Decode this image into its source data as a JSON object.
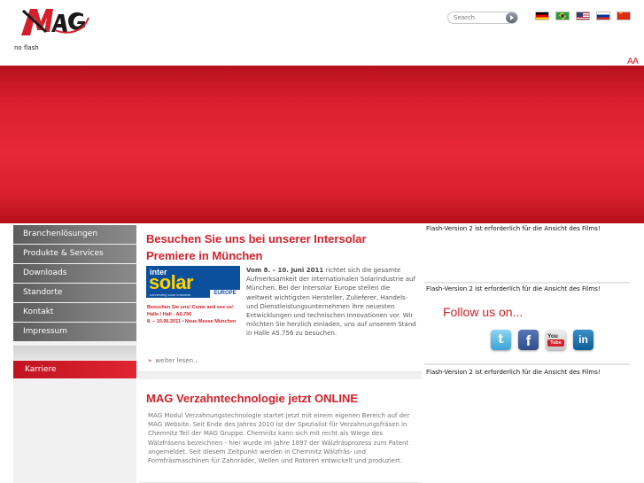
{
  "header": {
    "logo_text": "MAG",
    "noflash": "no flash",
    "search_placeholder": "Search",
    "font_size_control": "AA",
    "flags": [
      "german-flag-icon",
      "brazil-flag-icon",
      "usa-flag-icon",
      "russia-flag-icon",
      "china-flag-icon"
    ]
  },
  "sidebar": {
    "items": [
      {
        "label": "Branchenlösungen"
      },
      {
        "label": "Produkte & Services"
      },
      {
        "label": "Downloads"
      },
      {
        "label": "Standorte"
      },
      {
        "label": "Kontakt"
      },
      {
        "label": "Impressum"
      }
    ],
    "karriere": "Karriere"
  },
  "articles": [
    {
      "title": "Besuchen Sie uns bei unserer Intersolar Premiere in München",
      "date_bold": "Vom 8. – 10. Juni 2011",
      "body": " richtet sich die gesamte Aufmerksamkeit der internationalen Solarindustrie auf München. Bei der Intersolar Europe stellen die weltweit wichtigsten Hersteller, Zulieferer, Handels- und Dienstleistungsunternehmen ihre neuesten Entwicklungen und technischen Innovationen vor. Wir möchten Sie herzlich einladen, uns auf unserem Stand in Halle A5.756 zu besuchen.",
      "more": "weiter lesen...",
      "ad": {
        "inter": "inter",
        "solar": "solar",
        "tagline": "connecting solar business",
        "europe": "EUROPE",
        "line1": "Besuchen Sie uns! Come and see us!",
        "line2": "Halle / Hall - A5.756",
        "line3": "8. – 10.06.2011 • Neue Messe München"
      }
    },
    {
      "title": "MAG Verzahntechnologie jetzt ONLINE",
      "body": "MAG Modul Verzahnungstechnologie startet jetzt mit einem eigenen Bereich auf der MAG Website. Seit Ende des Jahres 2010 ist der Spezialist für Verzahnungsfräsen in Chemnitz Teil der MAG Gruppe. Chemnitz kann sich mit recht als Wiege des Wälzfräsens bezeichnen - hier wurde im Jahre 1897 der Wälzfräsprozess zum Patent angemeldet. Seit diesem Zeitpunkt werden in Chemnitz Wälzfräs- und Formfräsmaschinen für Zahnräder, Wellen und Rotoren entwickelt und produziert."
    }
  ],
  "right": {
    "flash_notice_1": "Flash-Version 2 ist erforderlich für die Ansicht des Films!",
    "flash_notice_2": "Flash-Version 2 ist erforderlich für die Ansicht des Films!",
    "flash_notice_3": "Flash-Version 2 ist erforderlich für die Ansicht des Films!",
    "follow": "Follow us on...",
    "social": {
      "twitter": "t",
      "facebook": "f",
      "youtube_you": "You",
      "youtube_tube": "Tube",
      "linkedin": "in"
    }
  },
  "colors": {
    "brand_red": "#d4202a",
    "banner_red": "#e62837",
    "nav_grey": "#6a6a6a"
  }
}
